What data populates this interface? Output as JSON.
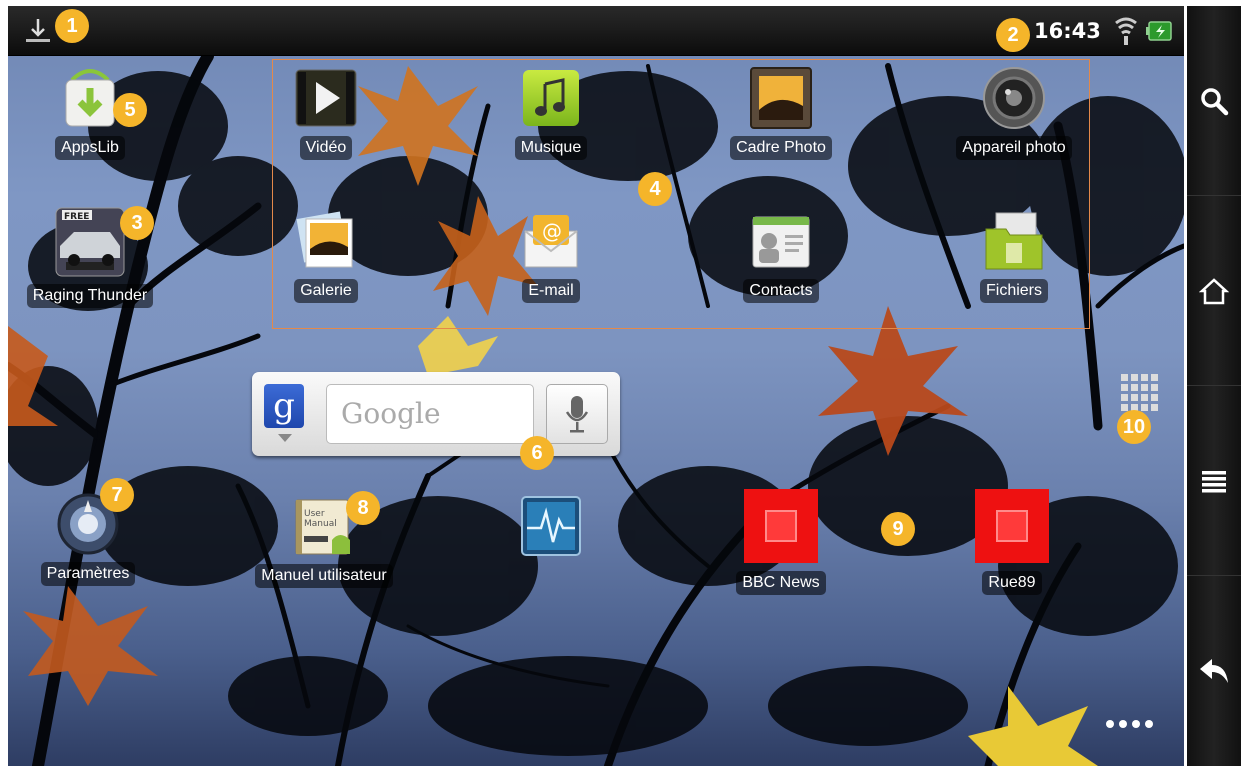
{
  "status_bar": {
    "time": "16:43",
    "icons": [
      "download-notification-icon",
      "wifi-icon",
      "battery-charging-icon"
    ]
  },
  "apps": {
    "appslib": "AppsLib",
    "raging_thunder": "Raging Thunder",
    "video": "Vidéo",
    "musique": "Musique",
    "cadre_photo": "Cadre Photo",
    "appareil_photo": "Appareil photo",
    "galerie": "Galerie",
    "email": "E-mail",
    "contacts": "Contacts",
    "fichiers": "Fichiers",
    "parametres": "Paramètres",
    "manuel": "Manuel utilisateur",
    "bbc": "BBC News",
    "rue89": "Rue89"
  },
  "search_widget": {
    "logo": "g",
    "placeholder": "Google"
  },
  "callouts": [
    "1",
    "2",
    "3",
    "4",
    "5",
    "6",
    "7",
    "8",
    "9",
    "10"
  ],
  "sidebar": [
    "search-icon",
    "home-icon",
    "menu-icon",
    "back-icon"
  ],
  "colors": {
    "callout": "#f5b52a",
    "folder_outline": "#e4894a",
    "rss_red": "#ee1111"
  }
}
